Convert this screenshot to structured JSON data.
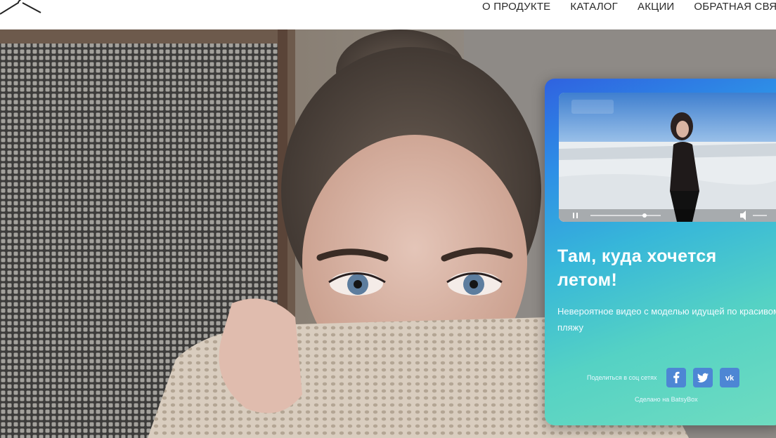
{
  "header": {
    "logo_icon": "hanger-icon",
    "nav": [
      {
        "label": "О ПРОДУКТЕ"
      },
      {
        "label": "КАТАЛОГ"
      },
      {
        "label": "АКЦИИ"
      },
      {
        "label": "ОБРАТНАЯ СВЯЗЬ"
      }
    ]
  },
  "widget": {
    "title": "Там, куда хочется летом!",
    "description": "Невероятное видео с моделью идущей по красивому пляжу",
    "share_label": "Поделиться в соц сетях",
    "share": [
      {
        "icon": "facebook-icon",
        "glyph": "f"
      },
      {
        "icon": "twitter-icon",
        "glyph": "🐦"
      },
      {
        "icon": "vk-icon",
        "glyph": "vk"
      }
    ],
    "made_with": "Сделано на BatsyBox"
  },
  "colors": {
    "widget_gradient_start": "#2f62e0",
    "widget_gradient_end": "#6fdcc0",
    "social_button": "#4d86d4"
  }
}
